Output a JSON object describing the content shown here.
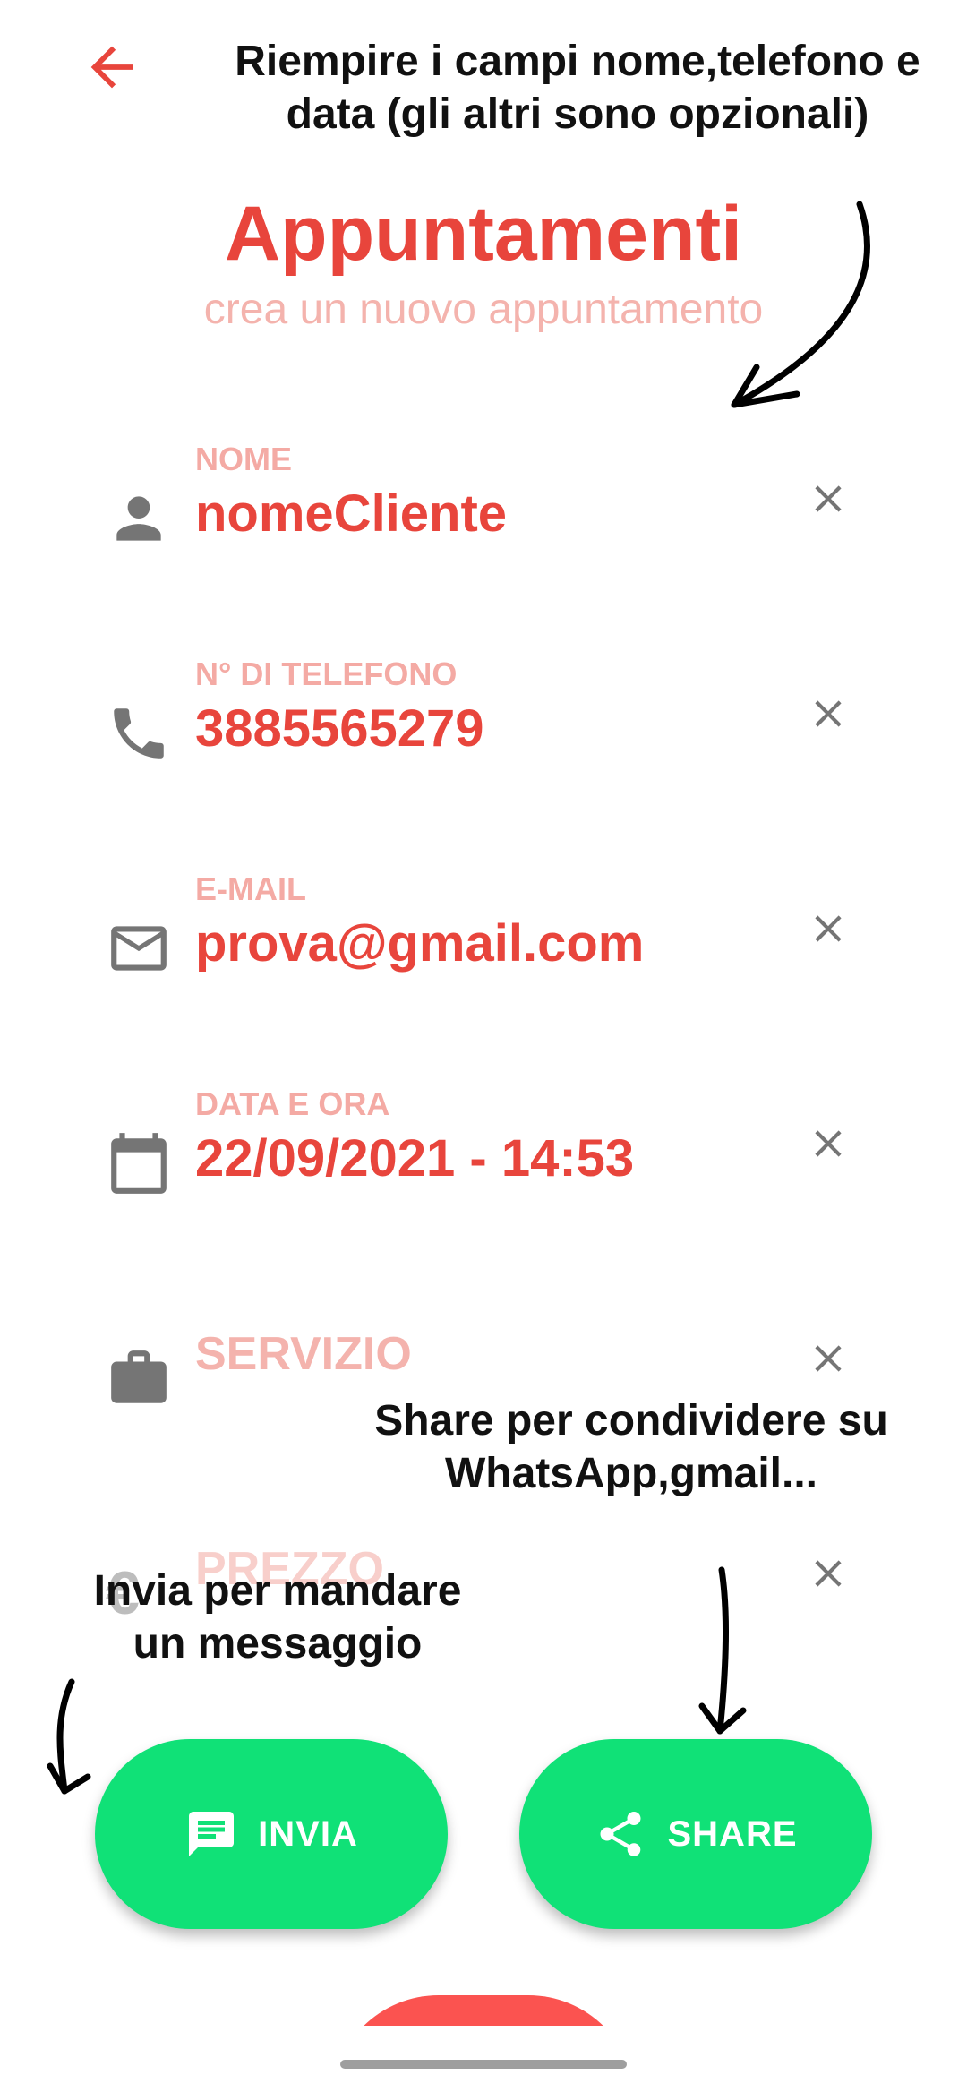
{
  "annotations": {
    "top_line1": "Riempire i campi nome,telefono e",
    "top_line2": "data (gli altri sono opzionali)",
    "share_line1": "Share per condividere su",
    "share_line2": "WhatsApp,gmail...",
    "invia_line1": "Invia per mandare",
    "invia_line2": "un messaggio"
  },
  "header": {
    "title": "Appuntamenti",
    "subtitle": "crea un nuovo appuntamento"
  },
  "fields": [
    {
      "icon": "person-icon",
      "label": "NOME",
      "value": "nomeCliente"
    },
    {
      "icon": "phone-icon",
      "label": "N° DI TELEFONO",
      "value": "3885565279"
    },
    {
      "icon": "mail-icon",
      "label": "E-MAIL",
      "value": "prova@gmail.com"
    },
    {
      "icon": "calendar-icon",
      "label": "DATA E ORA",
      "value": "22/09/2021 - 14:53"
    },
    {
      "icon": "briefcase-icon",
      "placeholder": "SERVIZIO"
    },
    {
      "icon": "euro-icon",
      "placeholder": "PREZZO"
    }
  ],
  "buttons": {
    "invia": {
      "label": "INVIA",
      "icon": "message-icon"
    },
    "share": {
      "label": "SHARE",
      "icon": "share-icon"
    }
  },
  "colors": {
    "accent": "#e8453c",
    "label": "#f4aaa4",
    "fab": "#10e177",
    "bottom_bar": "#fb5350"
  }
}
